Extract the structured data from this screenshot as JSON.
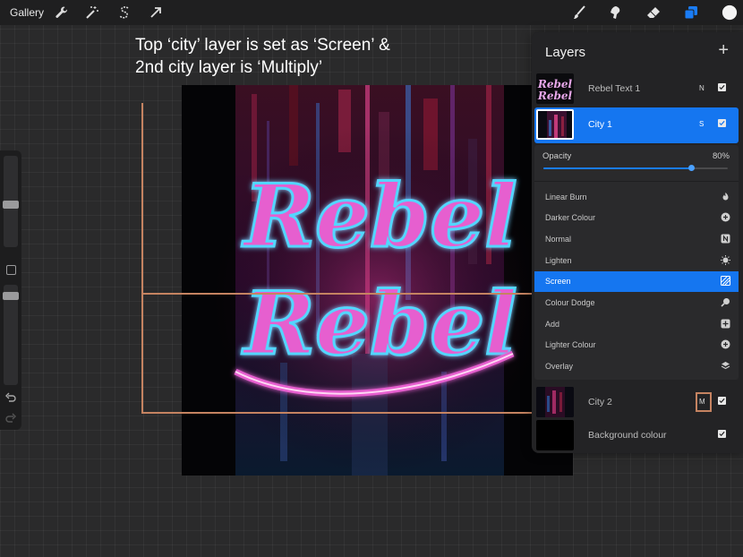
{
  "toolbar": {
    "gallery_label": "Gallery",
    "left_icons": [
      "wrench-icon",
      "magic-wand-icon",
      "selection-s-icon",
      "transform-arrow-icon"
    ],
    "right_icons": [
      "brush-icon",
      "smudge-icon",
      "eraser-icon",
      "layers-icon",
      "color-circle-icon"
    ]
  },
  "caption": {
    "line1": "Top ‘city’ layer is set as ‘Screen’ &",
    "line2": "2nd city layer is ‘Multiply’"
  },
  "layers_panel": {
    "title": "Layers",
    "add_symbol": "+",
    "layers": [
      {
        "name": "Rebel Text 1",
        "mode": "N",
        "visible": true,
        "selected": false
      },
      {
        "name": "City 1",
        "mode": "S",
        "visible": true,
        "selected": true
      },
      {
        "name": "City 2",
        "mode": "M",
        "visible": true,
        "selected": false
      },
      {
        "name": "Background colour",
        "mode": "",
        "visible": true,
        "selected": false
      }
    ],
    "opacity_label": "Opacity",
    "opacity_value": "80%",
    "opacity_fraction": 0.8,
    "blend_modes": [
      {
        "label": "Linear Burn",
        "icon": "flame-icon",
        "active": false
      },
      {
        "label": "Darker Colour",
        "icon": "plus-circle-icon",
        "active": false
      },
      {
        "label": "Normal",
        "icon": "n-box-icon",
        "active": false
      },
      {
        "label": "Lighten",
        "icon": "sun-icon",
        "active": false
      },
      {
        "label": "Screen",
        "icon": "hatch-icon",
        "active": true
      },
      {
        "label": "Colour Dodge",
        "icon": "magnifier-icon",
        "active": false
      },
      {
        "label": "Add",
        "icon": "plus-box-icon",
        "active": false
      },
      {
        "label": "Lighter Colour",
        "icon": "plus-circle-icon",
        "active": false
      },
      {
        "label": "Overlay",
        "icon": "stack-icon",
        "active": false
      }
    ]
  },
  "artwork": {
    "text_line1": "Rebel",
    "text_line2": "Rebel"
  },
  "colors": {
    "accent_blue": "#1576f0",
    "annotation": "#c58361",
    "text_pink": "#e65fcf",
    "glow_cyan": "#53d6ff"
  }
}
